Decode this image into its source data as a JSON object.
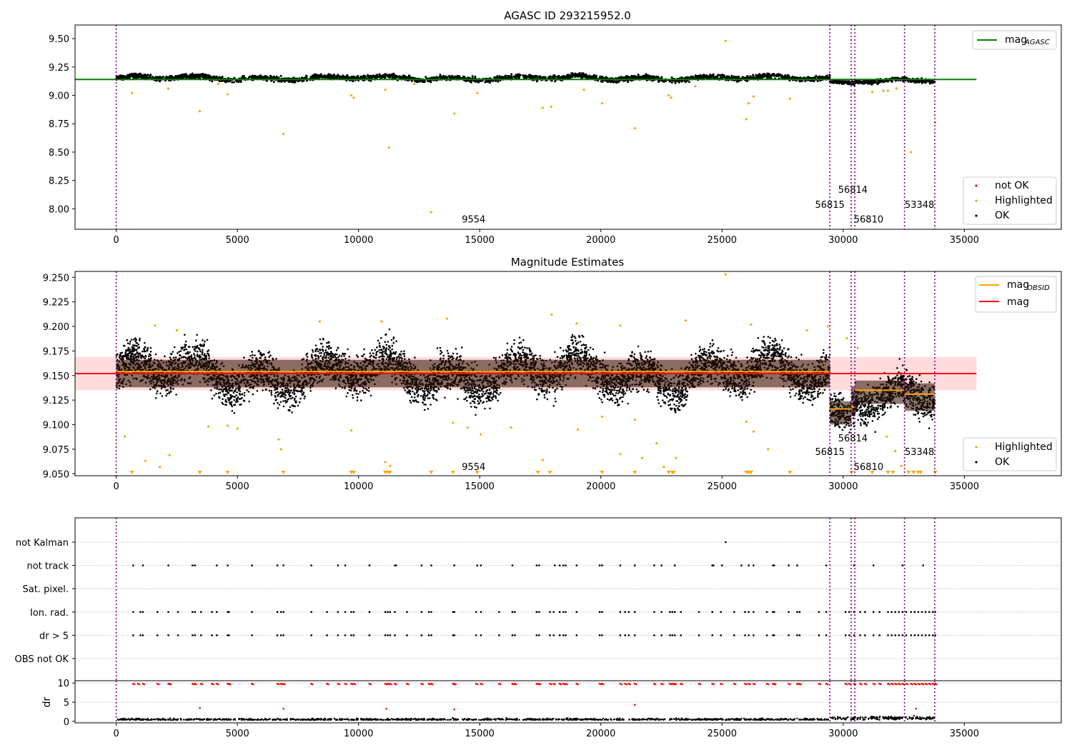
{
  "chart_data": [
    {
      "type": "scatter",
      "title": "AGASC ID 293215952.0",
      "xlabel": "",
      "ylabel": "",
      "xlim": [
        -1700,
        39000
      ],
      "ylim": [
        7.82,
        9.62
      ],
      "xticks": [
        0,
        5000,
        10000,
        15000,
        20000,
        25000,
        30000,
        35000
      ],
      "yticks": [
        8.0,
        8.25,
        8.5,
        8.75,
        9.0,
        9.25,
        9.5
      ],
      "ytick_labels": [
        "8.00",
        "8.25",
        "8.50",
        "8.75",
        "9.00",
        "9.25",
        "9.50"
      ],
      "grid": false,
      "obsid_boundaries": [
        0,
        29450,
        30330,
        30480,
        32530,
        33780
      ],
      "obsid_labels": [
        {
          "text": "9554",
          "x": 14750,
          "y": 7.88
        },
        {
          "text": "56815",
          "x": 29450,
          "y": 8.01
        },
        {
          "text": "56814",
          "x": 30400,
          "y": 8.14
        },
        {
          "text": "56810",
          "x": 31050,
          "y": 7.88
        },
        {
          "text": "53348",
          "x": 33150,
          "y": 8.01
        }
      ],
      "ok_segments": [
        {
          "x0": 0,
          "x1": 29450,
          "center": 9.152,
          "spread": 0.022
        },
        {
          "x0": 29450,
          "x1": 30330,
          "center": 9.115,
          "spread": 0.015
        },
        {
          "x0": 30330,
          "x1": 30480,
          "center": 9.12,
          "spread": 0.02
        },
        {
          "x0": 30480,
          "x1": 32530,
          "center": 9.135,
          "spread": 0.018
        },
        {
          "x0": 32530,
          "x1": 33780,
          "center": 9.131,
          "spread": 0.02
        }
      ],
      "highlighted_points": [
        [
          13000,
          7.97
        ],
        [
          6900,
          8.66
        ],
        [
          11250,
          8.54
        ],
        [
          21400,
          8.71
        ],
        [
          32800,
          8.5
        ],
        [
          3450,
          8.86
        ],
        [
          13950,
          8.84
        ],
        [
          17600,
          8.89
        ],
        [
          17950,
          8.9
        ],
        [
          20050,
          8.93
        ],
        [
          25150,
          9.48
        ],
        [
          26000,
          8.79
        ],
        [
          33800,
          8.76
        ],
        [
          26100,
          8.93
        ],
        [
          26300,
          8.99
        ],
        [
          9700,
          9.0
        ],
        [
          9800,
          8.98
        ],
        [
          4600,
          9.01
        ],
        [
          14900,
          9.02
        ],
        [
          22800,
          9.0
        ],
        [
          22900,
          8.98
        ],
        [
          27800,
          8.97
        ],
        [
          11100,
          9.05
        ],
        [
          19300,
          9.05
        ],
        [
          31650,
          9.04
        ],
        [
          31850,
          9.04
        ],
        [
          32200,
          9.06
        ],
        [
          30450,
          9.02
        ],
        [
          31200,
          9.03
        ],
        [
          650,
          9.02
        ],
        [
          2150,
          9.06
        ],
        [
          4200,
          9.1
        ],
        [
          23900,
          9.08
        ],
        [
          12300,
          9.1
        ]
      ],
      "lines": [
        {
          "name": "mag",
          "sub": "AGASC",
          "color": "#008000",
          "y": 9.14,
          "x0": -1700,
          "x1": 35500
        }
      ],
      "legend_top": {
        "label": "mag",
        "sub": "AGASC"
      },
      "legend_bottom": [
        "not OK",
        "Highlighted",
        "OK"
      ],
      "colors": {
        "ok": "#000000",
        "highlighted": "#ffa500",
        "not_ok": "#ff0000",
        "obsid_line": "#800080"
      }
    },
    {
      "type": "scatter",
      "title": "Magnitude Estimates",
      "xlabel": "",
      "ylabel": "",
      "xlim": [
        -1700,
        39000
      ],
      "ylim": [
        9.048,
        9.256
      ],
      "xticks": [
        0,
        5000,
        10000,
        15000,
        20000,
        25000,
        30000,
        35000
      ],
      "yticks": [
        9.05,
        9.075,
        9.1,
        9.125,
        9.15,
        9.175,
        9.2,
        9.225,
        9.25
      ],
      "ytick_labels": [
        "9.050",
        "9.075",
        "9.100",
        "9.125",
        "9.150",
        "9.175",
        "9.200",
        "9.225",
        "9.250"
      ],
      "grid": false,
      "obsid_boundaries": [
        0,
        29450,
        30330,
        30480,
        32530,
        33780
      ],
      "obsid_labels": [
        {
          "text": "9554",
          "x": 14750,
          "y": 9.054
        },
        {
          "text": "56815",
          "x": 29450,
          "y": 9.069
        },
        {
          "text": "56814",
          "x": 30400,
          "y": 9.083
        },
        {
          "text": "56810",
          "x": 31050,
          "y": 9.054
        },
        {
          "text": "53348",
          "x": 33150,
          "y": 9.069
        }
      ],
      "band": {
        "y0": 9.135,
        "y1": 9.169,
        "x0": -1700,
        "x1": 35500,
        "color": "#ffc0c0"
      },
      "mag_line": {
        "name": "mag",
        "y": 9.152,
        "color": "#ff0000",
        "x0": -1700,
        "x1": 35500
      },
      "mag_obsid_segments": [
        {
          "x0": 0,
          "x1": 29450,
          "y": 9.154
        },
        {
          "x0": 29450,
          "x1": 30330,
          "y": 9.116
        },
        {
          "x0": 30330,
          "x1": 30480,
          "y": 9.118
        },
        {
          "x0": 30480,
          "x1": 32530,
          "y": 9.135
        },
        {
          "x0": 32530,
          "x1": 33780,
          "y": 9.131
        }
      ],
      "ok_segments": [
        {
          "x0": 0,
          "x1": 29450,
          "center": 9.152,
          "spread": 0.02
        },
        {
          "x0": 29450,
          "x1": 30330,
          "center": 9.112,
          "spread": 0.017
        },
        {
          "x0": 30330,
          "x1": 30480,
          "center": 9.125,
          "spread": 0.02
        },
        {
          "x0": 30480,
          "x1": 32530,
          "center": 9.133,
          "spread": 0.017
        },
        {
          "x0": 32530,
          "x1": 33780,
          "center": 9.128,
          "spread": 0.02
        }
      ],
      "highlighted_points": [
        [
          25150,
          9.253
        ],
        [
          350,
          9.088
        ],
        [
          1200,
          9.063
        ],
        [
          2200,
          9.069
        ],
        [
          1800,
          9.057
        ],
        [
          3800,
          9.098
        ],
        [
          4600,
          9.099
        ],
        [
          5000,
          9.096
        ],
        [
          6700,
          9.085
        ],
        [
          6800,
          9.075
        ],
        [
          9700,
          9.094
        ],
        [
          11100,
          9.062
        ],
        [
          11300,
          9.058
        ],
        [
          13900,
          9.102
        ],
        [
          14500,
          9.097
        ],
        [
          15050,
          9.09
        ],
        [
          16300,
          9.097
        ],
        [
          17600,
          9.064
        ],
        [
          19050,
          9.095
        ],
        [
          20050,
          9.108
        ],
        [
          20800,
          9.07
        ],
        [
          21400,
          9.105
        ],
        [
          21700,
          9.066
        ],
        [
          22300,
          9.081
        ],
        [
          22600,
          9.057
        ],
        [
          23100,
          9.066
        ],
        [
          26000,
          9.103
        ],
        [
          26300,
          9.093
        ],
        [
          26900,
          9.075
        ],
        [
          31800,
          9.088
        ],
        [
          32150,
          9.073
        ],
        [
          32400,
          9.058
        ],
        [
          30150,
          9.188
        ],
        [
          30600,
          9.178
        ],
        [
          2500,
          9.196
        ],
        [
          1600,
          9.201
        ],
        [
          8400,
          9.205
        ],
        [
          10950,
          9.205
        ],
        [
          13650,
          9.208
        ],
        [
          17970,
          9.212
        ],
        [
          19000,
          9.203
        ],
        [
          20800,
          9.201
        ],
        [
          23500,
          9.206
        ],
        [
          26200,
          9.202
        ],
        [
          28500,
          9.196
        ],
        [
          29380,
          9.2
        ]
      ],
      "lower_limit_markers_x": [
        650,
        3450,
        4600,
        6900,
        9700,
        9800,
        11100,
        11200,
        11300,
        13000,
        13900,
        14900,
        17400,
        17900,
        20050,
        21400,
        22800,
        22950,
        23000,
        26000,
        26100,
        26200,
        27800,
        30350,
        31200,
        31850,
        32050,
        32700,
        32900,
        33100,
        33200,
        33800
      ],
      "legend_top": [
        {
          "label": "mag",
          "sub": "OBSID"
        },
        {
          "label": "mag",
          "sub": ""
        }
      ],
      "legend_bottom": [
        "Highlighted",
        "OK"
      ],
      "colors": {
        "ok": "#000000",
        "ok_dense": "#2a1000",
        "highlighted": "#ffa500",
        "obsid_line": "#800080",
        "mag_obsid": "#ffa500"
      }
    },
    {
      "type": "scatter",
      "title": "",
      "xlabel": "",
      "ylabel": "",
      "xlim": [
        -1700,
        39000
      ],
      "grid": true,
      "categories": [
        "not Kalman",
        "not track",
        "Sat. pixel.",
        "Ion. rad.",
        "dr > 5",
        "OBS not OK"
      ],
      "flag_x": {
        "not Kalman": [
          25150
        ],
        "not track": [
          700,
          1100,
          2150,
          3150,
          3250,
          4150,
          4600,
          5600,
          6650,
          6900,
          8050,
          9150,
          9450,
          10450,
          11500,
          11550,
          12600,
          13000,
          13950,
          14900,
          15050,
          16350,
          17350,
          17450,
          18100,
          18300,
          18450,
          18550,
          19000,
          19950,
          20050,
          20800,
          21400,
          22200,
          22500,
          23050,
          24600,
          24650,
          25000,
          25800,
          26100,
          26300,
          27100,
          27150,
          27750,
          28100,
          29300,
          30450,
          31250,
          32450,
          33300
        ],
        "Ion. rad.": [
          700,
          1000,
          1100,
          1700,
          2150,
          2550,
          3150,
          3250,
          3500,
          3950,
          4150,
          4600,
          4650,
          5600,
          6650,
          6800,
          6900,
          8050,
          8700,
          9150,
          9450,
          9700,
          9800,
          10450,
          11100,
          11200,
          11300,
          11500,
          12000,
          12600,
          12900,
          13000,
          13900,
          13950,
          14850,
          15050,
          15800,
          16350,
          16450,
          17350,
          17450,
          17900,
          18050,
          18300,
          18450,
          18550,
          19000,
          19950,
          20050,
          20800,
          21000,
          21150,
          21400,
          22200,
          22500,
          22850,
          22950,
          23050,
          23300,
          24050,
          24600,
          24950,
          25500,
          25950,
          26100,
          26300,
          26850,
          27100,
          27150,
          27750,
          28100,
          28200,
          29000,
          29300,
          30100,
          30250,
          30450,
          30700,
          30900,
          31250,
          31500,
          31850,
          32000,
          32150,
          32300,
          32450,
          32600,
          32800,
          32950,
          33100,
          33250,
          33400,
          33550,
          33700,
          33800
        ],
        "dr > 5": [
          700,
          1000,
          1100,
          1700,
          2150,
          2550,
          3150,
          3250,
          3500,
          3950,
          4150,
          4600,
          4650,
          5600,
          6650,
          6800,
          6900,
          8050,
          8700,
          9150,
          9450,
          9700,
          9800,
          10450,
          11100,
          11200,
          11300,
          11500,
          12000,
          12600,
          12900,
          13000,
          13900,
          13950,
          14850,
          15050,
          15800,
          16350,
          16450,
          17350,
          17450,
          17900,
          18050,
          18300,
          18450,
          18550,
          19000,
          19950,
          20050,
          20800,
          21000,
          21150,
          21400,
          22200,
          22500,
          22850,
          22950,
          23050,
          23300,
          24050,
          24600,
          24950,
          25500,
          25950,
          26100,
          26300,
          26850,
          27100,
          27150,
          27750,
          28100,
          28200,
          29000,
          29300,
          30100,
          30250,
          30450,
          30700,
          30900,
          31250,
          31500,
          31850,
          32000,
          32150,
          32300,
          32450,
          32600,
          32800,
          32950,
          33100,
          33250,
          33400,
          33550,
          33700,
          33800
        ]
      },
      "obsid_boundaries": [
        0,
        29450,
        30330,
        30480,
        32530,
        33780
      ],
      "colors": {
        "flag": "#000000",
        "obsid_line": "#800080",
        "grid": "#b0b0b0"
      }
    },
    {
      "type": "scatter",
      "title": "",
      "xlabel": "",
      "ylabel": "dr",
      "xlim": [
        -1700,
        39000
      ],
      "ylim": [
        -0.4,
        10.6
      ],
      "xticks": [
        0,
        5000,
        10000,
        15000,
        20000,
        25000,
        30000,
        35000
      ],
      "yticks": [
        0,
        5,
        10
      ],
      "grid": true,
      "dr_over_limit_x": [
        700,
        900,
        1100,
        1700,
        2150,
        2200,
        3150,
        3250,
        3500,
        3950,
        4150,
        4600,
        4650,
        5600,
        6650,
        6800,
        6900,
        8050,
        8700,
        9150,
        9450,
        9700,
        9800,
        10450,
        11100,
        11200,
        11300,
        11500,
        12000,
        12600,
        12900,
        13000,
        13900,
        13950,
        14850,
        15050,
        15800,
        16350,
        16450,
        17350,
        17450,
        17900,
        18050,
        18300,
        18450,
        18550,
        19000,
        19950,
        20050,
        20800,
        21000,
        21150,
        21400,
        22200,
        22500,
        22850,
        22950,
        23050,
        23300,
        24050,
        24600,
        24950,
        25500,
        25950,
        26100,
        26300,
        26850,
        27100,
        27150,
        27750,
        28100,
        28200,
        29000,
        29300,
        30100,
        30250,
        30450,
        30700,
        30900,
        31250,
        31500,
        31850,
        32000,
        32150,
        32300,
        32450,
        32600,
        32800,
        32950,
        33100,
        33250,
        33400,
        33550,
        33700,
        33800
      ],
      "dr_mid_points": [
        [
          3450,
          3.5
        ],
        [
          6900,
          3.3
        ],
        [
          11150,
          3.3
        ],
        [
          13950,
          3.1
        ],
        [
          21400,
          4.3
        ],
        [
          33000,
          3.3
        ]
      ],
      "dr_typical": 0.35,
      "obsid_boundaries": [
        0,
        29450,
        30330,
        30480,
        32530,
        33780
      ],
      "colors": {
        "ok": "#000000",
        "over": "#ff0000",
        "obsid_line": "#800080",
        "grid": "#b0b0b0"
      }
    }
  ]
}
